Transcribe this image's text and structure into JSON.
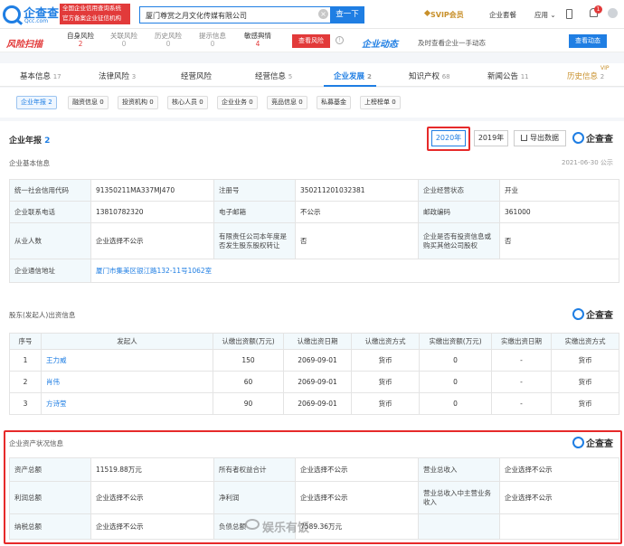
{
  "header": {
    "logo_name": "企查查",
    "logo_domain": "Qcc.com",
    "notice_lines": [
      "全国企业信用查询系统",
      "官方备案企业征信机构"
    ],
    "search_value": "厦门尊赏之月文化传媒有限公司",
    "search_button": "查一下",
    "svip": "SVIP会员",
    "links": [
      "企业套餐",
      "应用"
    ],
    "notification_count": "1"
  },
  "risk": {
    "title": "风险扫描",
    "items": [
      {
        "label": "自身风险",
        "count": "2"
      },
      {
        "label": "关联风险",
        "count": "0"
      },
      {
        "label": "历史风险",
        "count": "0"
      },
      {
        "label": "提示信息",
        "count": "0"
      },
      {
        "label": "敏感舆情",
        "count": "4"
      }
    ],
    "view_button": "查看风险",
    "info_icon": "!"
  },
  "trend": {
    "title": "企业动态",
    "desc": "及时查看企业一手动态",
    "button": "查看动态"
  },
  "tabs": [
    {
      "label": "基本信息",
      "count": "17"
    },
    {
      "label": "法律风险",
      "count": "3"
    },
    {
      "label": "经营风险",
      "count": ""
    },
    {
      "label": "经营信息",
      "count": "5"
    },
    {
      "label": "企业发展",
      "count": "2"
    },
    {
      "label": "知识产权",
      "count": "68"
    },
    {
      "label": "新闻公告",
      "count": "11"
    },
    {
      "label": "历史信息",
      "count": "2"
    }
  ],
  "vip_tag": "VIP",
  "subtabs": [
    "企业年报 2",
    "融资信息 0",
    "投资机构 0",
    "核心人员 0",
    "企业业务 0",
    "竞品信息 0",
    "私募基金",
    "上榜榜单 0"
  ],
  "report": {
    "title": "企业年报",
    "count": "2",
    "years": [
      "2020年",
      "2019年"
    ],
    "export": "导出数据",
    "brand": "企查查",
    "basic_heading": "企业基本信息",
    "date": "2021-06-30 公示",
    "basic_rows": [
      [
        "统一社会信用代码",
        "91350211MA337MJ470",
        "注册号",
        "350211201032381",
        "企业经营状态",
        "开业"
      ],
      [
        "企业联系电话",
        "13810782320",
        "电子邮箱",
        "不公示",
        "邮政编码",
        "361000"
      ],
      [
        "从业人数",
        "企业选择不公示",
        "有限责任公司本年度是否发生股东股权转让",
        "否",
        "企业是否有投资信息或购买其他公司股权",
        "否"
      ]
    ],
    "address_label": "企业通信地址",
    "address_value": "厦门市集美区银江路132-11号1062室",
    "shareholder_heading": "股东(发起人)出资信息",
    "sh_columns": [
      "序号",
      "发起人",
      "认缴出资额(万元)",
      "认缴出资日期",
      "认缴出资方式",
      "实缴出资额(万元)",
      "实缴出资日期",
      "实缴出资方式"
    ],
    "sh_rows": [
      [
        "1",
        "王力威",
        "150",
        "2069-09-01",
        "货币",
        "0",
        "-",
        "货币"
      ],
      [
        "2",
        "肖伟",
        "60",
        "2069-09-01",
        "货币",
        "0",
        "-",
        "货币"
      ],
      [
        "3",
        "方诗莹",
        "90",
        "2069-09-01",
        "货币",
        "0",
        "-",
        "货币"
      ]
    ],
    "asset_heading": "企业资产状况信息",
    "asset_rows": [
      [
        "资产总额",
        "11519.88万元",
        "所有者权益合计",
        "企业选择不公示",
        "营业总收入",
        "企业选择不公示"
      ],
      [
        "利润总额",
        "企业选择不公示",
        "净利润",
        "企业选择不公示",
        "营业总收入中主营业务收入",
        "企业选择不公示"
      ],
      [
        "纳税总额",
        "企业选择不公示",
        "负债总额",
        "7589.36万元",
        "",
        ""
      ]
    ],
    "watermark": "娱乐有饭"
  }
}
